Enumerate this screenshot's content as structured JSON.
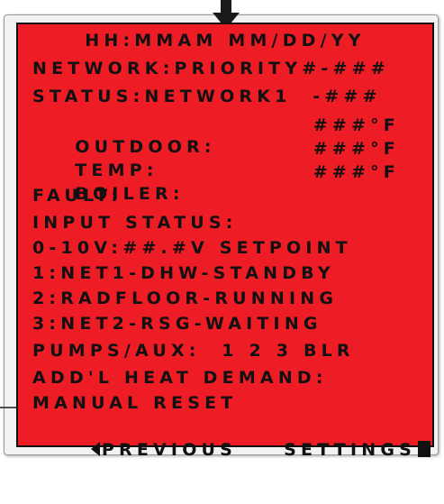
{
  "screen": {
    "header": "HH:MMAM MM/DD/YY",
    "network": "NETWORK:PRIORITY#-###",
    "status": "STATUS:NETWORK1  -###",
    "outdoor": {
      "label": "OUTDOOR:",
      "value": "###°F"
    },
    "temp": {
      "label": "TEMP:",
      "value": "###°F"
    },
    "boiler": {
      "label": "BOILER:",
      "value": "###°F"
    },
    "fault": "FAULT:",
    "input_status": "INPUT STATUS:",
    "analog": "0-10V:##.#V SETPOINT",
    "zone1": "1:NET1-DHW-STANDBY",
    "zone2": "2:RADFLOOR-RUNNING",
    "zone3": "3:NET2-RSG-WAITING",
    "pumps": "PUMPS/AUX:  1 2 3 BLR",
    "addl_heat": "ADD'L HEAT DEMAND:",
    "manual_reset": "MANUAL RESET",
    "previous_label": "PREVIOUS",
    "settings_label": "SETTINGS"
  },
  "colors": {
    "screen": "#ee1c24",
    "text": "#111111",
    "bezel": "#f2f2f2"
  }
}
